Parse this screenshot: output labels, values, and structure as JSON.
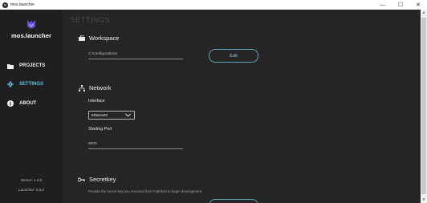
{
  "window": {
    "title": "mos.launcher",
    "minimize": "—",
    "maximize": "☐",
    "close": "✕"
  },
  "sidebar": {
    "logo_text": "mos.launcher",
    "items": [
      {
        "label": "PROJECTS",
        "icon": "folder-icon"
      },
      {
        "label": "SETTINGS",
        "icon": "gear-icon",
        "active": true
      },
      {
        "label": "ABOUT",
        "icon": "info-icon"
      }
    ],
    "server_version": "Server: 1.4.0",
    "launcher_version": "Launcher: 2.5.0"
  },
  "main": {
    "page_title": "SETTINGS",
    "workspace": {
      "title": "Workspace",
      "path": "C:\\configurations",
      "edit_label": "Edit"
    },
    "network": {
      "title": "Network",
      "interface_label": "Interface",
      "interface_value": "Ethernet0",
      "port_label": "Starting Port",
      "port_value": "8000"
    },
    "secretkey": {
      "title": "Secretkey",
      "hint": "Provide the secret key you received from Fabrik19 to begin development."
    }
  },
  "colors": {
    "accent": "#5bc3dc",
    "background": "#252525",
    "sidebar": "#1f1f1f"
  }
}
